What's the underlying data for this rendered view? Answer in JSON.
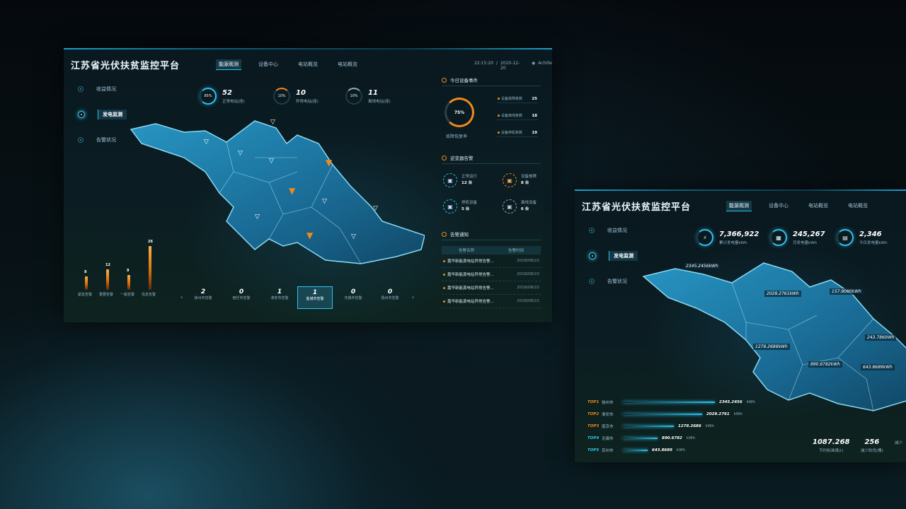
{
  "colors": {
    "accent": "#2fc3ef",
    "warning": "#f08a1c",
    "background": "#07121a"
  },
  "p1": {
    "title": "江苏省光伏扶贫监控平台",
    "tabs": [
      "能源观测",
      "设备中心",
      "电站概览",
      "电站概览"
    ],
    "time": "22:15:20",
    "date": "2020-12-20",
    "user": "Achille",
    "side": [
      "收益情况",
      "发电监测",
      "告警状况"
    ],
    "stats": [
      {
        "ring": "85%",
        "value": "52",
        "label": "正常电站(座)"
      },
      {
        "ring": "10%",
        "value": "10",
        "label": "异常电站(座)"
      },
      {
        "ring": "10%",
        "value": "11",
        "label": "离线电站(座)"
      }
    ],
    "events": {
      "title": "今日设备事件",
      "ring": "75%",
      "ring_label": "故障恢复率",
      "rows": [
        {
          "label": "设备故障条数",
          "value": "25"
        },
        {
          "label": "设备离线条数",
          "value": "18"
        },
        {
          "label": "设备停机条数",
          "value": "19"
        }
      ]
    },
    "inverter": {
      "title": "逆变器告警",
      "items": [
        {
          "label": "正常运行",
          "value": "12 台"
        },
        {
          "label": "设备故障",
          "value": "8 台"
        },
        {
          "label": "停机设备",
          "value": "5 台"
        },
        {
          "label": "离线设备",
          "value": "6 台"
        }
      ]
    },
    "alerts": {
      "title": "告警通知",
      "col_name": "告警名称",
      "col_time": "告警时间",
      "rows": [
        {
          "name": "嘉华新能源电站异常告警...",
          "time": "2018/08/22"
        },
        {
          "name": "嘉华新能源电站异常告警...",
          "time": "2018/08/22"
        },
        {
          "name": "嘉华新能源电站异常告警...",
          "time": "2018/08/22"
        },
        {
          "name": "嘉华新能源电站异常告警...",
          "time": "2018/08/22"
        }
      ]
    },
    "bars": [
      {
        "label": "紧急告警",
        "value": "8",
        "n": 8
      },
      {
        "label": "重要告警",
        "value": "12",
        "n": 12
      },
      {
        "label": "一般告警",
        "value": "9",
        "n": 9
      },
      {
        "label": "信息告警",
        "value": "26",
        "n": 26
      }
    ],
    "cities": [
      {
        "count": "2",
        "label": "徐州市告警"
      },
      {
        "count": "0",
        "label": "宿迁市告警"
      },
      {
        "count": "1",
        "label": "淮安市告警"
      },
      {
        "count": "1",
        "label": "盐城市告警"
      },
      {
        "count": "0",
        "label": "无锡市告警"
      },
      {
        "count": "0",
        "label": "扬州市告警"
      }
    ]
  },
  "p2": {
    "title": "江苏省光伏扶贫监控平台",
    "tabs": [
      "能源观测",
      "设备中心",
      "电站概览",
      "电站概览"
    ],
    "side": [
      "收益情况",
      "发电监测",
      "告警状况"
    ],
    "stats": [
      {
        "value": "7,366,922",
        "label": "累计发电量kWh"
      },
      {
        "value": "245,267",
        "label": "月发电量kWh"
      },
      {
        "value": "2,346",
        "label": "今日发电量kWh"
      }
    ],
    "map_labels": [
      "2345.2456kWh",
      "2028.2761kWh",
      "157.9080kWh",
      "1278.2686kWh",
      "243.7860Wh",
      "890.6782kWh",
      "643.8689kWh"
    ],
    "top": [
      {
        "rank": "TOP1",
        "city": "徐州市",
        "value": "2345.2456",
        "unit": "kWh",
        "frac": 1.0
      },
      {
        "rank": "TOP2",
        "city": "淮安市",
        "value": "2028.2761",
        "unit": "kWh",
        "frac": 0.86
      },
      {
        "rank": "TOP3",
        "city": "南京市",
        "value": "1278.2686",
        "unit": "kWh",
        "frac": 0.55
      },
      {
        "rank": "TOP4",
        "city": "无锡市",
        "value": "890.6782",
        "unit": "kWh",
        "frac": 0.38
      },
      {
        "rank": "TOP5",
        "city": "苏州市",
        "value": "643.8689",
        "unit": "kWh",
        "frac": 0.27
      }
    ],
    "saving": [
      {
        "value": "1087.268",
        "label": "节约标准煤(t)"
      },
      {
        "value": "256",
        "label": "减少砍伐(棵)"
      },
      {
        "value": "",
        "label": "减少"
      }
    ]
  }
}
